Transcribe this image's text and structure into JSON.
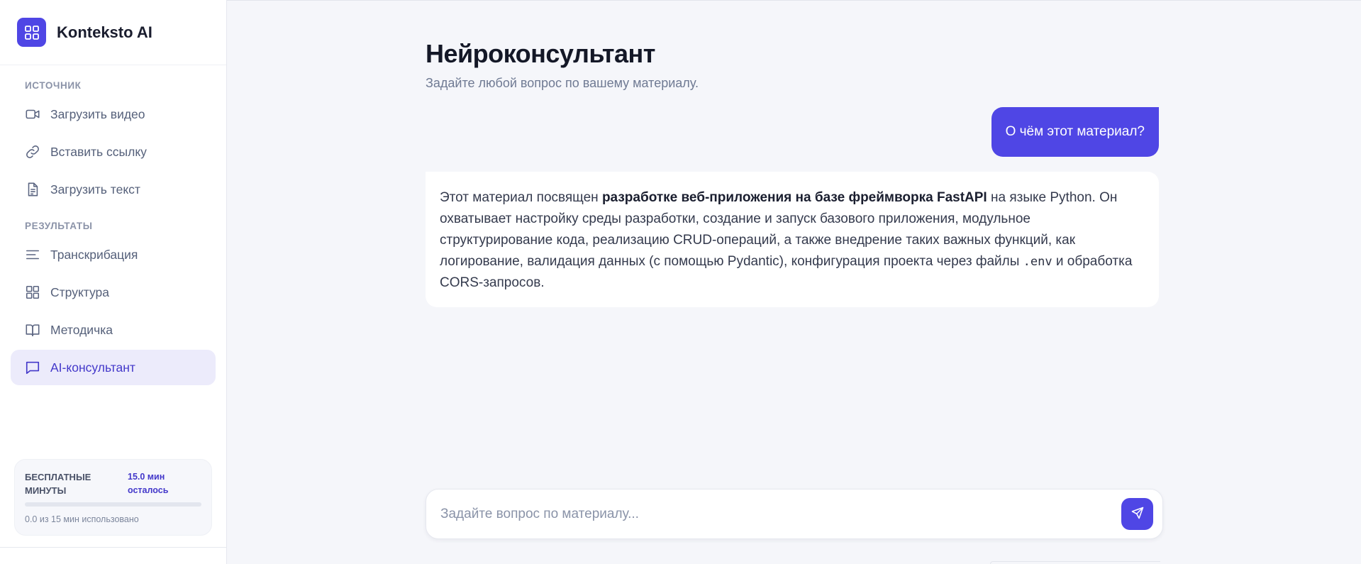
{
  "brand": {
    "name": "Konteksto AI"
  },
  "sidebar": {
    "source_label": "Источник",
    "source_items": [
      {
        "label": "Загрузить видео",
        "icon": "video-icon"
      },
      {
        "label": "Вставить ссылку",
        "icon": "link-icon"
      },
      {
        "label": "Загрузить текст",
        "icon": "document-icon"
      }
    ],
    "results_label": "Результаты",
    "results_items": [
      {
        "label": "Транскрибация",
        "icon": "lines-icon"
      },
      {
        "label": "Структура",
        "icon": "grid-icon"
      },
      {
        "label": "Методичка",
        "icon": "book-icon"
      },
      {
        "label": "AI-консультант",
        "icon": "chat-icon",
        "active": true
      }
    ],
    "minutes": {
      "title": "Бесплатные минуты",
      "left": "15.0 мин осталось",
      "used_text": "0.0 из 15 мин использовано",
      "used_fraction": 0.0
    }
  },
  "main": {
    "title": "Нейроконсультант",
    "subtitle": "Задайте любой вопрос по вашему материалу.",
    "user_message": "О чём этот материал?",
    "assistant_message": {
      "part1": "Этот материал посвящен ",
      "bold": "разработке веб-приложения на базе фреймворка FastAPI",
      "part2": " на языке Python. Он охватывает настройку среды разработки, создание и запуск базового приложения, модульное структурирование кода, реализацию CRUD-операций, а также внедрение таких важных функций, как логирование, валидация данных (с помощью Pydantic), конфигурация проекта через файлы ",
      "code": ".env",
      "part3": " и обработка CORS-запросов."
    },
    "composer": {
      "placeholder": "Задайте вопрос по материалу..."
    }
  },
  "colors": {
    "accent": "#4f46e5",
    "active_bg": "#ecebfb",
    "active_text": "#4338ca"
  }
}
